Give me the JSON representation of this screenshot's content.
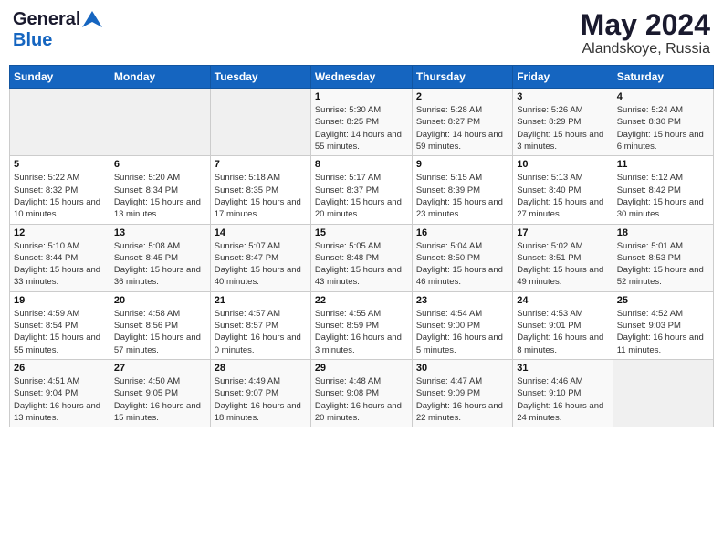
{
  "header": {
    "logo_general": "General",
    "logo_blue": "Blue",
    "month": "May 2024",
    "location": "Alandskoye, Russia"
  },
  "weekdays": [
    "Sunday",
    "Monday",
    "Tuesday",
    "Wednesday",
    "Thursday",
    "Friday",
    "Saturday"
  ],
  "weeks": [
    [
      {
        "day": "",
        "sunrise": "",
        "sunset": "",
        "daylight": ""
      },
      {
        "day": "",
        "sunrise": "",
        "sunset": "",
        "daylight": ""
      },
      {
        "day": "",
        "sunrise": "",
        "sunset": "",
        "daylight": ""
      },
      {
        "day": "1",
        "sunrise": "Sunrise: 5:30 AM",
        "sunset": "Sunset: 8:25 PM",
        "daylight": "Daylight: 14 hours and 55 minutes."
      },
      {
        "day": "2",
        "sunrise": "Sunrise: 5:28 AM",
        "sunset": "Sunset: 8:27 PM",
        "daylight": "Daylight: 14 hours and 59 minutes."
      },
      {
        "day": "3",
        "sunrise": "Sunrise: 5:26 AM",
        "sunset": "Sunset: 8:29 PM",
        "daylight": "Daylight: 15 hours and 3 minutes."
      },
      {
        "day": "4",
        "sunrise": "Sunrise: 5:24 AM",
        "sunset": "Sunset: 8:30 PM",
        "daylight": "Daylight: 15 hours and 6 minutes."
      }
    ],
    [
      {
        "day": "5",
        "sunrise": "Sunrise: 5:22 AM",
        "sunset": "Sunset: 8:32 PM",
        "daylight": "Daylight: 15 hours and 10 minutes."
      },
      {
        "day": "6",
        "sunrise": "Sunrise: 5:20 AM",
        "sunset": "Sunset: 8:34 PM",
        "daylight": "Daylight: 15 hours and 13 minutes."
      },
      {
        "day": "7",
        "sunrise": "Sunrise: 5:18 AM",
        "sunset": "Sunset: 8:35 PM",
        "daylight": "Daylight: 15 hours and 17 minutes."
      },
      {
        "day": "8",
        "sunrise": "Sunrise: 5:17 AM",
        "sunset": "Sunset: 8:37 PM",
        "daylight": "Daylight: 15 hours and 20 minutes."
      },
      {
        "day": "9",
        "sunrise": "Sunrise: 5:15 AM",
        "sunset": "Sunset: 8:39 PM",
        "daylight": "Daylight: 15 hours and 23 minutes."
      },
      {
        "day": "10",
        "sunrise": "Sunrise: 5:13 AM",
        "sunset": "Sunset: 8:40 PM",
        "daylight": "Daylight: 15 hours and 27 minutes."
      },
      {
        "day": "11",
        "sunrise": "Sunrise: 5:12 AM",
        "sunset": "Sunset: 8:42 PM",
        "daylight": "Daylight: 15 hours and 30 minutes."
      }
    ],
    [
      {
        "day": "12",
        "sunrise": "Sunrise: 5:10 AM",
        "sunset": "Sunset: 8:44 PM",
        "daylight": "Daylight: 15 hours and 33 minutes."
      },
      {
        "day": "13",
        "sunrise": "Sunrise: 5:08 AM",
        "sunset": "Sunset: 8:45 PM",
        "daylight": "Daylight: 15 hours and 36 minutes."
      },
      {
        "day": "14",
        "sunrise": "Sunrise: 5:07 AM",
        "sunset": "Sunset: 8:47 PM",
        "daylight": "Daylight: 15 hours and 40 minutes."
      },
      {
        "day": "15",
        "sunrise": "Sunrise: 5:05 AM",
        "sunset": "Sunset: 8:48 PM",
        "daylight": "Daylight: 15 hours and 43 minutes."
      },
      {
        "day": "16",
        "sunrise": "Sunrise: 5:04 AM",
        "sunset": "Sunset: 8:50 PM",
        "daylight": "Daylight: 15 hours and 46 minutes."
      },
      {
        "day": "17",
        "sunrise": "Sunrise: 5:02 AM",
        "sunset": "Sunset: 8:51 PM",
        "daylight": "Daylight: 15 hours and 49 minutes."
      },
      {
        "day": "18",
        "sunrise": "Sunrise: 5:01 AM",
        "sunset": "Sunset: 8:53 PM",
        "daylight": "Daylight: 15 hours and 52 minutes."
      }
    ],
    [
      {
        "day": "19",
        "sunrise": "Sunrise: 4:59 AM",
        "sunset": "Sunset: 8:54 PM",
        "daylight": "Daylight: 15 hours and 55 minutes."
      },
      {
        "day": "20",
        "sunrise": "Sunrise: 4:58 AM",
        "sunset": "Sunset: 8:56 PM",
        "daylight": "Daylight: 15 hours and 57 minutes."
      },
      {
        "day": "21",
        "sunrise": "Sunrise: 4:57 AM",
        "sunset": "Sunset: 8:57 PM",
        "daylight": "Daylight: 16 hours and 0 minutes."
      },
      {
        "day": "22",
        "sunrise": "Sunrise: 4:55 AM",
        "sunset": "Sunset: 8:59 PM",
        "daylight": "Daylight: 16 hours and 3 minutes."
      },
      {
        "day": "23",
        "sunrise": "Sunrise: 4:54 AM",
        "sunset": "Sunset: 9:00 PM",
        "daylight": "Daylight: 16 hours and 5 minutes."
      },
      {
        "day": "24",
        "sunrise": "Sunrise: 4:53 AM",
        "sunset": "Sunset: 9:01 PM",
        "daylight": "Daylight: 16 hours and 8 minutes."
      },
      {
        "day": "25",
        "sunrise": "Sunrise: 4:52 AM",
        "sunset": "Sunset: 9:03 PM",
        "daylight": "Daylight: 16 hours and 11 minutes."
      }
    ],
    [
      {
        "day": "26",
        "sunrise": "Sunrise: 4:51 AM",
        "sunset": "Sunset: 9:04 PM",
        "daylight": "Daylight: 16 hours and 13 minutes."
      },
      {
        "day": "27",
        "sunrise": "Sunrise: 4:50 AM",
        "sunset": "Sunset: 9:05 PM",
        "daylight": "Daylight: 16 hours and 15 minutes."
      },
      {
        "day": "28",
        "sunrise": "Sunrise: 4:49 AM",
        "sunset": "Sunset: 9:07 PM",
        "daylight": "Daylight: 16 hours and 18 minutes."
      },
      {
        "day": "29",
        "sunrise": "Sunrise: 4:48 AM",
        "sunset": "Sunset: 9:08 PM",
        "daylight": "Daylight: 16 hours and 20 minutes."
      },
      {
        "day": "30",
        "sunrise": "Sunrise: 4:47 AM",
        "sunset": "Sunset: 9:09 PM",
        "daylight": "Daylight: 16 hours and 22 minutes."
      },
      {
        "day": "31",
        "sunrise": "Sunrise: 4:46 AM",
        "sunset": "Sunset: 9:10 PM",
        "daylight": "Daylight: 16 hours and 24 minutes."
      },
      {
        "day": "",
        "sunrise": "",
        "sunset": "",
        "daylight": ""
      }
    ]
  ]
}
